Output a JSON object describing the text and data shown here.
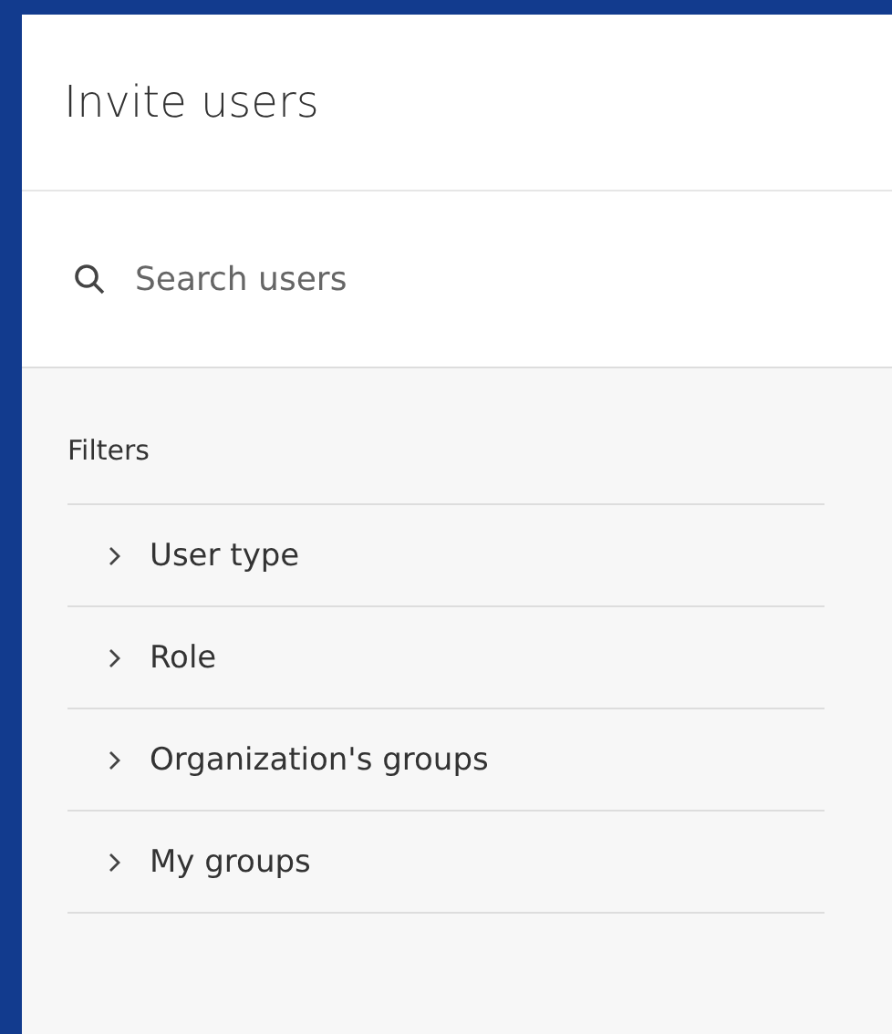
{
  "panel": {
    "title": "Invite users"
  },
  "search": {
    "placeholder": "Search users"
  },
  "filters": {
    "heading": "Filters",
    "items": [
      {
        "label": "User type",
        "expanded": false
      },
      {
        "label": "Role",
        "expanded": false
      },
      {
        "label": "Organization's groups",
        "expanded": false
      },
      {
        "label": "My groups",
        "expanded": false
      }
    ]
  }
}
